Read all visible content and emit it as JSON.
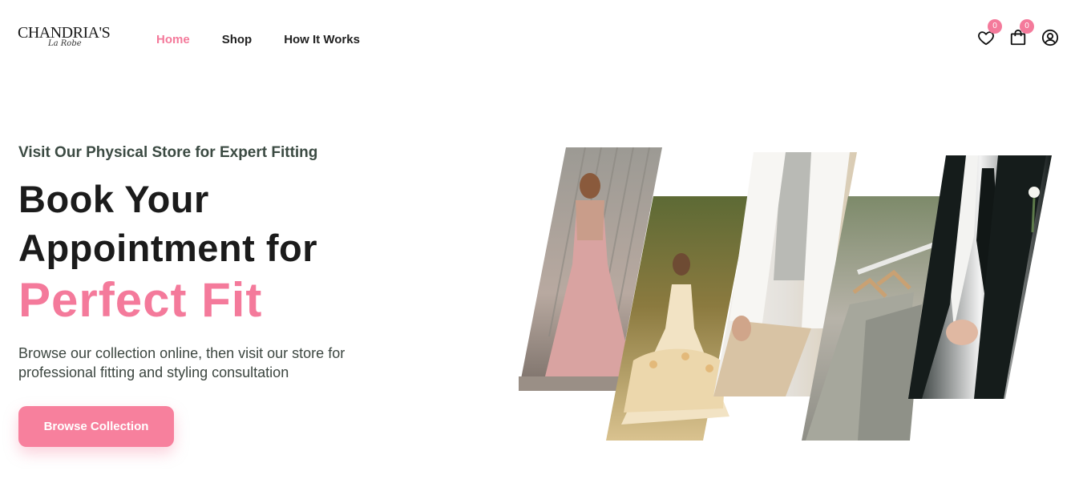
{
  "brand": {
    "name": "CHANDRIA'S",
    "tagline": "La Robe"
  },
  "nav": {
    "items": [
      {
        "label": "Home",
        "active": true
      },
      {
        "label": "Shop",
        "active": false
      },
      {
        "label": "How It Works",
        "active": false
      }
    ]
  },
  "header_icons": {
    "wishlist": {
      "icon": "heart-icon",
      "count": "0"
    },
    "cart": {
      "icon": "shopping-bag-icon",
      "count": "0"
    },
    "account": {
      "icon": "user-circle-icon"
    }
  },
  "hero": {
    "eyebrow": "Visit Our Physical Store for Expert Fitting",
    "title_line1": "Book Your",
    "title_line2": "Appointment for",
    "title_accent": "Perfect Fit",
    "description": "Browse our collection online, then visit our store for professional fitting and styling consultation",
    "cta_label": "Browse Collection"
  },
  "colors": {
    "accent": "#f47a9b",
    "text_dark": "#1b1b1b",
    "text_muted": "#3c4640"
  },
  "collage": {
    "photos": [
      {
        "subject": "woman in pink tulle gown"
      },
      {
        "subject": "girl in ivory ball gown"
      },
      {
        "subject": "man in white blazer"
      },
      {
        "subject": "suits on hangers"
      },
      {
        "subject": "man in black suit and tie"
      }
    ]
  }
}
